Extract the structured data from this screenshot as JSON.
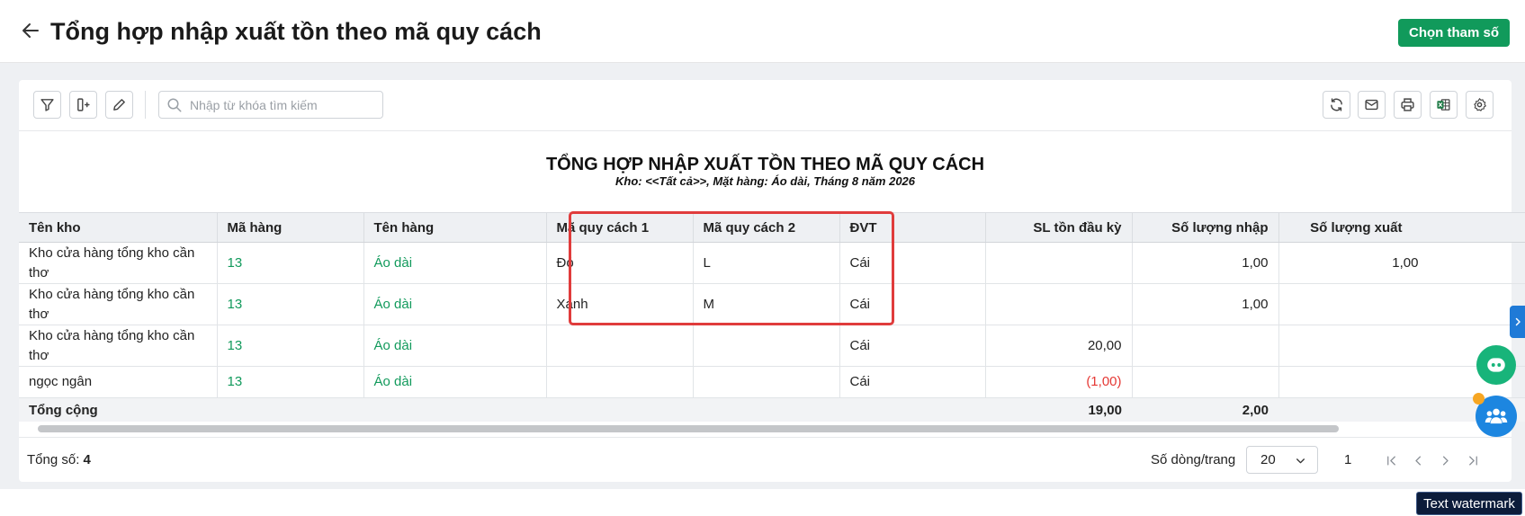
{
  "header": {
    "title": "Tổng hợp nhập xuất tồn theo mã quy cách",
    "action_button": "Chọn tham số"
  },
  "toolbar": {
    "search_placeholder": "Nhập từ khóa tìm kiếm",
    "left_icons": [
      "filter-icon",
      "column-insert-icon",
      "edit-icon"
    ],
    "right_icons": [
      "refresh-icon",
      "email-icon",
      "print-icon",
      "excel-icon",
      "settings-icon"
    ]
  },
  "report": {
    "title": "TỔNG HỢP NHẬP XUẤT TỒN THEO MÃ QUY CÁCH",
    "subtitle": "Kho: <<Tất cả>>, Mặt hàng: Áo dài, Tháng 8 năm 2026"
  },
  "table": {
    "columns": [
      "Tên kho",
      "Mã hàng",
      "Tên hàng",
      "Mã quy cách 1",
      "Mã quy cách 2",
      "ĐVT",
      "SL tồn đầu kỳ",
      "Số lượng nhập",
      "Số lượng xuất"
    ],
    "rows": [
      {
        "ten_kho": "Kho cửa hàng tổng kho cần thơ",
        "ma_hang": "13",
        "ten_hang": "Áo dài",
        "qc1": "Đỏ",
        "qc2": "L",
        "dvt": "Cái",
        "sl_ton_dau": "",
        "sl_nhap": "1,00",
        "sl_xuat": "1,00"
      },
      {
        "ten_kho": "Kho cửa hàng tổng kho cần thơ",
        "ma_hang": "13",
        "ten_hang": "Áo dài",
        "qc1": "Xanh",
        "qc2": "M",
        "dvt": "Cái",
        "sl_ton_dau": "",
        "sl_nhap": "1,00",
        "sl_xuat": ""
      },
      {
        "ten_kho": "Kho cửa hàng tổng kho cần thơ",
        "ma_hang": "13",
        "ten_hang": "Áo dài",
        "qc1": "",
        "qc2": "",
        "dvt": "Cái",
        "sl_ton_dau": "20,00",
        "sl_nhap": "",
        "sl_xuat": ""
      },
      {
        "ten_kho": "ngọc ngân",
        "ma_hang": "13",
        "ten_hang": "Áo dài",
        "qc1": "",
        "qc2": "",
        "dvt": "Cái",
        "sl_ton_dau": "(1,00)",
        "sl_nhap": "",
        "sl_xuat": ""
      }
    ],
    "total": {
      "label": "Tổng cộng",
      "sl_ton_dau": "19,00",
      "sl_nhap": "2,00",
      "sl_xuat": ""
    }
  },
  "footer": {
    "total_label": "Tổng số:",
    "total_value": "4",
    "rows_per_page_label": "Số dòng/trang",
    "rows_per_page": "20",
    "page": "1"
  },
  "colors": {
    "primary": "#119a5b",
    "link": "#129a5c",
    "negative": "#e53935",
    "highlight_box": "#e03c3c"
  },
  "watermark": "Text watermark"
}
